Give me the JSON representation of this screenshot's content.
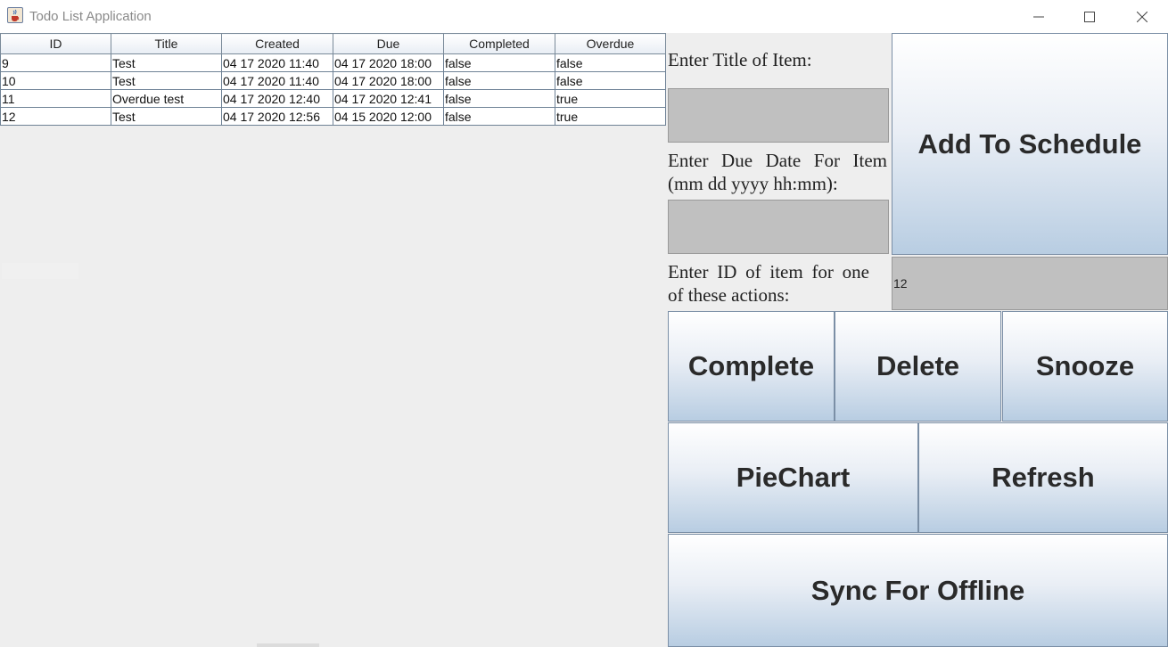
{
  "window": {
    "title": "Todo List Application",
    "icon": "java-cup-icon"
  },
  "table": {
    "columns": [
      "ID",
      "Title",
      "Created",
      "Due",
      "Completed",
      "Overdue"
    ],
    "rows": [
      [
        "9",
        "Test",
        "04 17 2020 11:40",
        "04 17 2020 18:00",
        "false",
        "false"
      ],
      [
        "10",
        "Test",
        "04 17 2020 11:40",
        "04 17 2020 18:00",
        "false",
        "false"
      ],
      [
        "11",
        "Overdue test",
        "04 17 2020 12:40",
        "04 17 2020 12:41",
        "false",
        "true"
      ],
      [
        "12",
        "Test",
        "04 17 2020 12:56",
        "04 15 2020 12:00",
        "false",
        "true"
      ]
    ]
  },
  "form": {
    "title_label": "Enter Title of Item:",
    "title_value": "",
    "due_label": "Enter Due Date For Item (mm dd yyyy hh:mm):",
    "due_value": "",
    "id_label": "Enter ID of item for one of these actions:",
    "id_value": "12"
  },
  "buttons": {
    "add": "Add To Schedule",
    "complete": "Complete",
    "delete": "Delete",
    "snooze": "Snooze",
    "piechart": "PieChart",
    "refresh": "Refresh",
    "sync": "Sync For Offline"
  },
  "colors": {
    "field_bg": "#c0c0c0",
    "button_gradient_bottom": "#b8cde2"
  }
}
